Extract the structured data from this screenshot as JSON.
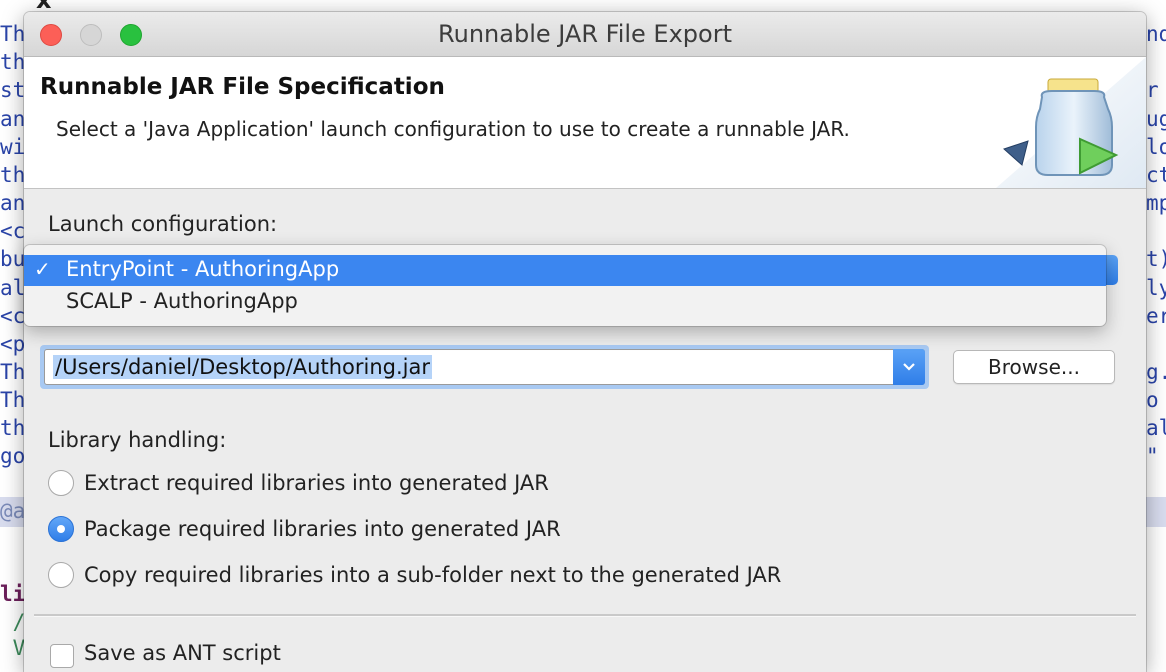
{
  "window": {
    "title": "Runnable JAR File Export"
  },
  "banner": {
    "title": "Runnable JAR File Specification",
    "description": "Select a 'Java Application' launch configuration to use to create a runnable JAR."
  },
  "launch": {
    "label": "Launch configuration:",
    "options": [
      {
        "label": "EntryPoint - AuthoringApp",
        "selected": true
      },
      {
        "label": "SCALP - AuthoringApp",
        "selected": false
      }
    ],
    "check_glyph": "✓"
  },
  "destination": {
    "value": "/Users/daniel/Desktop/Authoring.jar",
    "browse_label": "Browse..."
  },
  "library": {
    "label": "Library handling:",
    "options": [
      {
        "label": "Extract required libraries into generated JAR",
        "checked": false
      },
      {
        "label": "Package required libraries into generated JAR",
        "checked": true
      },
      {
        "label": "Copy required libraries into a sub-folder next to the generated JAR",
        "checked": false
      }
    ]
  },
  "ant": {
    "label": "Save as ANT script"
  },
  "editor": {
    "left_lines": [
      "Th",
      "th",
      "st",
      "an",
      "wi",
      "th",
      "an",
      "<c",
      "bu",
      "al",
      "<c",
      "<p",
      "Th",
      "Th",
      "th",
      "go"
    ],
    "right_lines": [
      "nd",
      "",
      "r",
      "ug",
      "lo",
      "ct",
      "mp",
      "",
      "t)",
      "ly",
      "er",
      "",
      "g.",
      "o",
      "al",
      "\""
    ],
    "annotation": "@a",
    "bottom_lines": [
      "li",
      " /",
      " V"
    ]
  },
  "colors": {
    "accent": "#3b86f0",
    "close": "#fc5f57",
    "minimize": "#d6d6d6",
    "maximize": "#29c13f",
    "code": "#2a44a8"
  }
}
